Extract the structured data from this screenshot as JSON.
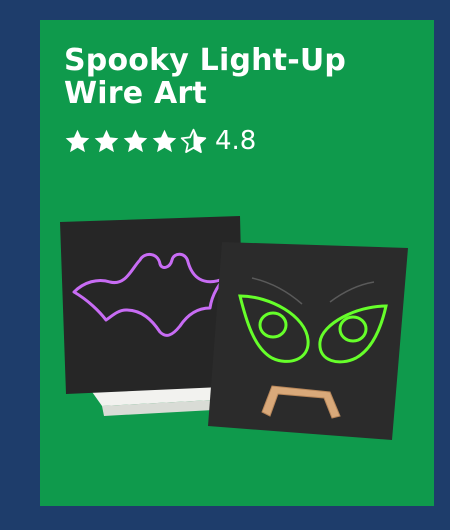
{
  "product": {
    "title": "Spooky Light-Up Wire Art",
    "rating_value": "4.8",
    "rating": 4.8,
    "max_rating": 5
  },
  "icons": [
    "star-icon",
    "half-star-icon"
  ],
  "colors": {
    "page_background": "#1e3d6b",
    "card_background": "#0f9a4c",
    "text": "#ffffff",
    "board": "#262626",
    "bat_wire": "#c86cf4",
    "eyes_wire": "#66ff2a",
    "stand": "#d9a97a"
  }
}
